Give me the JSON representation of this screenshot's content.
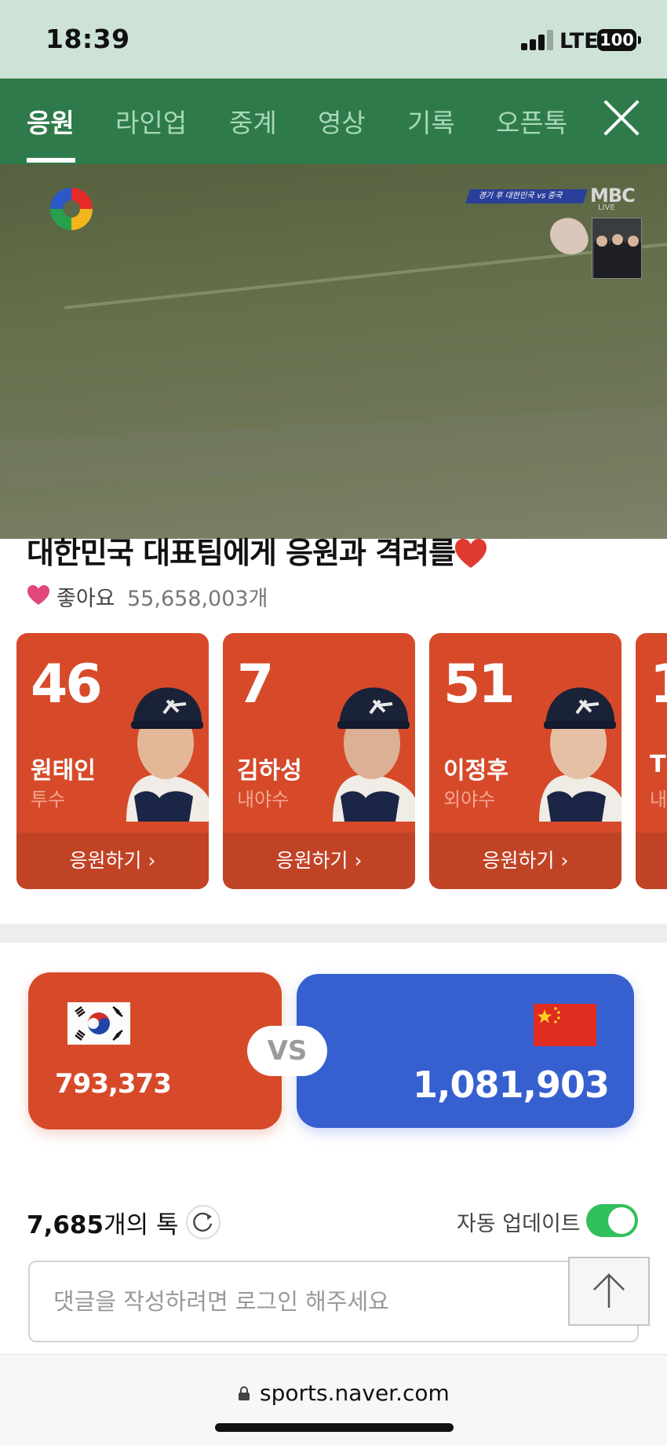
{
  "status_bar": {
    "time": "18:39",
    "network": "LTE",
    "battery": "100"
  },
  "tabs": [
    {
      "label": "응원",
      "active": true
    },
    {
      "label": "라인업",
      "active": false
    },
    {
      "label": "중계",
      "active": false
    },
    {
      "label": "영상",
      "active": false
    },
    {
      "label": "기록",
      "active": false
    },
    {
      "label": "오픈톡",
      "active": false
    }
  ],
  "video": {
    "broadcaster": "MBC",
    "broadcaster_sub": "LIVE",
    "score_chip": "경기 후 대한민국 vs 중국"
  },
  "cheer": {
    "title": "대한민국 대표팀에게 응원과 격려를",
    "like_label": "좋아요",
    "like_count": "55,658,003개"
  },
  "players": [
    {
      "number": "46",
      "name": "원태인",
      "position": "투수",
      "cheer_label": "응원하기 ›"
    },
    {
      "number": "7",
      "name": "김하성",
      "position": "내야수",
      "cheer_label": "응원하기 ›"
    },
    {
      "number": "51",
      "name": "이정후",
      "position": "외야수",
      "cheer_label": "응원하기 ›"
    },
    {
      "number": "1",
      "name": "T",
      "position": "내",
      "cheer_label": ""
    }
  ],
  "vs": {
    "left_score": "793,373",
    "right_score": "1,081,903",
    "badge": "VS",
    "left_color": "#d64a2a",
    "right_color": "#3660d0"
  },
  "talk": {
    "count": "7,685",
    "count_suffix": "개의 톡",
    "auto_update_label": "자동 업데이트",
    "auto_update_on": true,
    "comment_placeholder": "댓글을 작성하려면 로그인 해주세요"
  },
  "browser": {
    "url": "sports.naver.com"
  },
  "colors": {
    "tab_bar": "#2f7a4a",
    "status_bar": "#cde3d8",
    "toggle_on": "#31c15a"
  }
}
